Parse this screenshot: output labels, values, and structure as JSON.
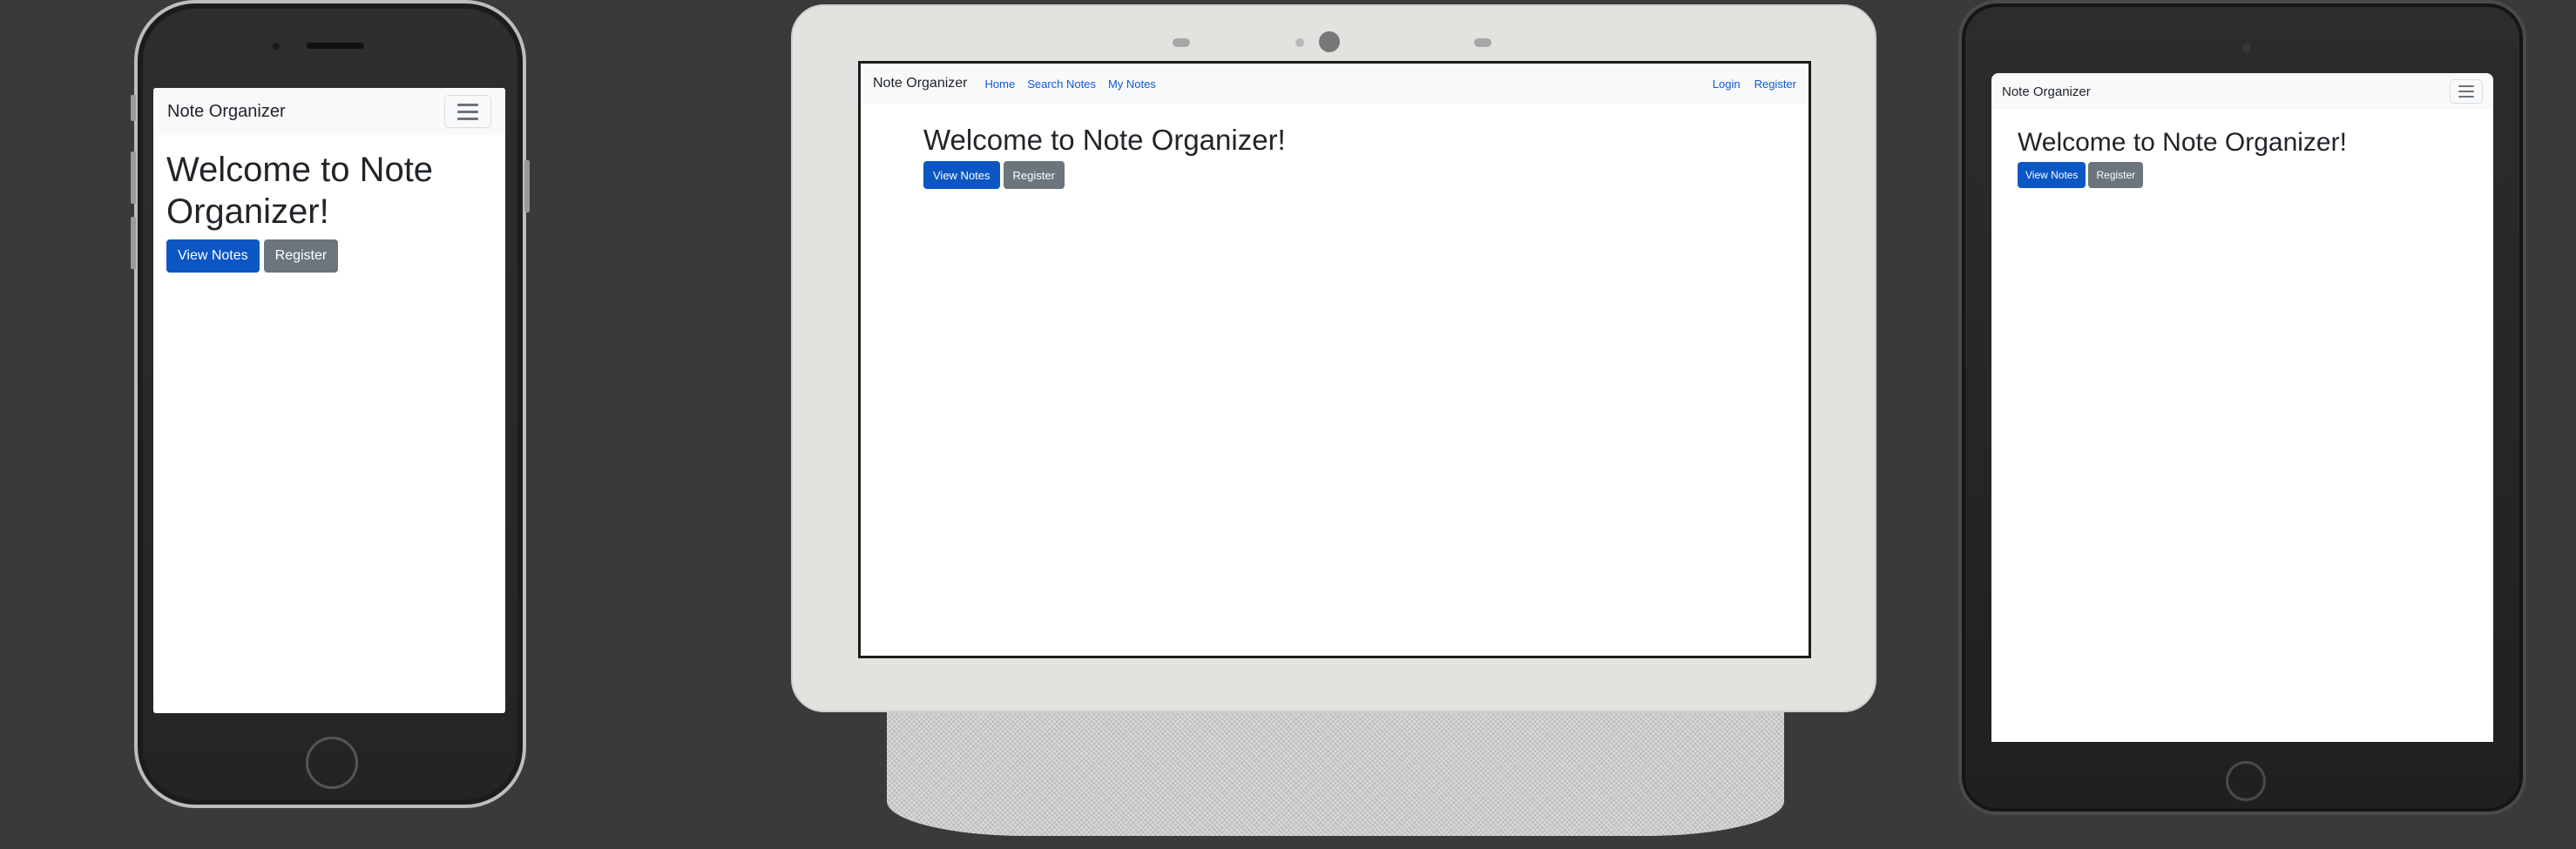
{
  "app": {
    "brand": "Note Organizer",
    "nav": {
      "home": "Home",
      "search_notes": "Search Notes",
      "my_notes": "My Notes",
      "login": "Login",
      "register": "Register"
    },
    "headline": "Welcome to Note Organizer!",
    "buttons": {
      "view_notes": "View Notes",
      "register": "Register"
    },
    "icons": {
      "menu": "hamburger-menu-icon"
    },
    "colors": {
      "primary": "#0b56c2",
      "secondary": "#6c757d",
      "link": "#0d5bd8",
      "navbar_bg": "#f8f9fa",
      "page_bg": "#3a3a3a"
    }
  }
}
